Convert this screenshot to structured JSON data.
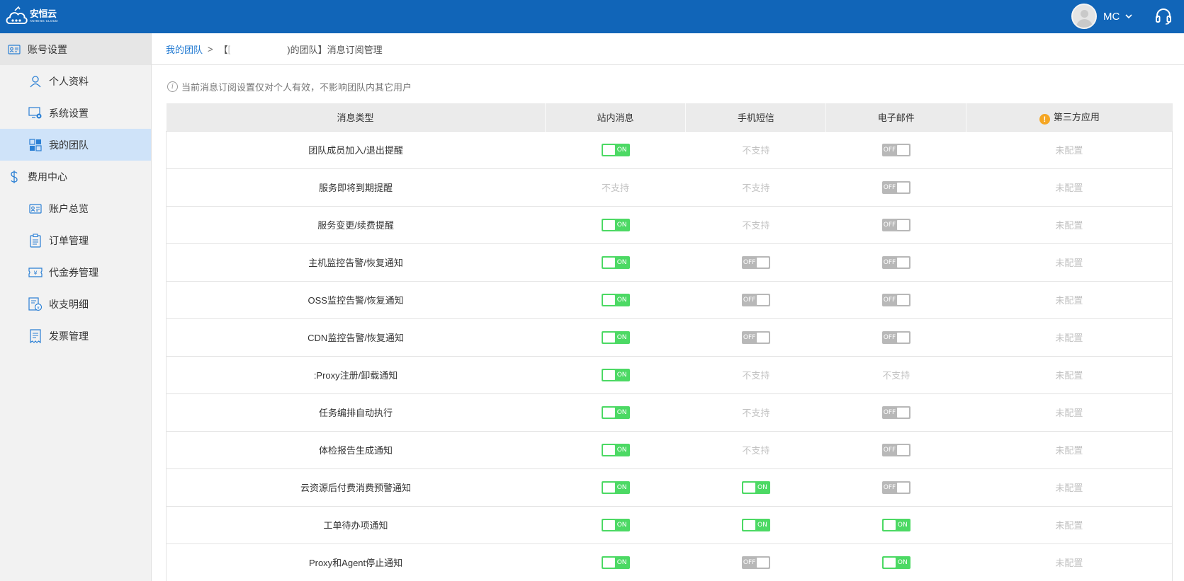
{
  "brand": {
    "name_cn": "安恒云",
    "name_en": "ANHENG CLOUD"
  },
  "user": {
    "name": "MC"
  },
  "sidebar": [
    {
      "label": "账号设置",
      "kind": "group",
      "icon": "id-card-icon",
      "name": "sidebar-group-account-settings"
    },
    {
      "label": "个人资料",
      "kind": "sub",
      "icon": "user-icon",
      "name": "sidebar-item-profile"
    },
    {
      "label": "系统设置",
      "kind": "sub",
      "icon": "monitor-gear-icon",
      "name": "sidebar-item-system-settings"
    },
    {
      "label": "我的团队",
      "kind": "sub",
      "icon": "grid-icon",
      "name": "sidebar-item-my-team",
      "active": true
    },
    {
      "label": "费用中心",
      "kind": "group",
      "icon": "dollar-icon",
      "name": "sidebar-group-billing"
    },
    {
      "label": "账户总览",
      "kind": "sub",
      "icon": "id-card-icon",
      "name": "sidebar-item-account-overview"
    },
    {
      "label": "订单管理",
      "kind": "sub",
      "icon": "clipboard-icon",
      "name": "sidebar-item-orders"
    },
    {
      "label": "代金券管理",
      "kind": "sub",
      "icon": "voucher-icon",
      "name": "sidebar-item-vouchers"
    },
    {
      "label": "收支明细",
      "kind": "sub",
      "icon": "statement-icon",
      "name": "sidebar-item-transactions"
    },
    {
      "label": "发票管理",
      "kind": "sub",
      "icon": "invoice-icon",
      "name": "sidebar-item-invoices"
    }
  ],
  "breadcrumb": {
    "link": "我的团队",
    "sep": ">",
    "open": "【",
    "obscured": "[",
    "suffix": ")的团队】消息订阅管理"
  },
  "notice": "当前消息订阅设置仅对个人有效，不影响团队内其它用户",
  "table": {
    "headers": [
      "消息类型",
      "站内消息",
      "手机短信",
      "电子邮件",
      "第三方应用"
    ],
    "rows": [
      {
        "type": "团队成员加入/退出提醒",
        "cells": [
          "ON",
          "不支持",
          "OFF",
          "未配置"
        ]
      },
      {
        "type": "服务即将到期提醒",
        "cells": [
          "不支持",
          "不支持",
          "OFF",
          "未配置"
        ]
      },
      {
        "type": "服务变更/续费提醒",
        "cells": [
          "ON",
          "不支持",
          "OFF",
          "未配置"
        ]
      },
      {
        "type": "主机监控告警/恢复通知",
        "cells": [
          "ON",
          "OFF",
          "OFF",
          "未配置"
        ]
      },
      {
        "type": "OSS监控告警/恢复通知",
        "cells": [
          "ON",
          "OFF",
          "OFF",
          "未配置"
        ]
      },
      {
        "type": "CDN监控告警/恢复通知",
        "cells": [
          "ON",
          "OFF",
          "OFF",
          "未配置"
        ]
      },
      {
        "type": ":Proxy注册/卸载通知",
        "cells": [
          "ON",
          "不支持",
          "不支持",
          "未配置"
        ]
      },
      {
        "type": "任务编排自动执行",
        "cells": [
          "ON",
          "不支持",
          "OFF",
          "未配置"
        ]
      },
      {
        "type": "体检报告生成通知",
        "cells": [
          "ON",
          "不支持",
          "OFF",
          "未配置"
        ]
      },
      {
        "type": "云资源后付费消费预警通知",
        "cells": [
          "ON",
          "ON",
          "OFF",
          "未配置"
        ]
      },
      {
        "type": "工单待办项通知",
        "cells": [
          "ON",
          "ON",
          "ON",
          "未配置"
        ]
      },
      {
        "type": "Proxy和Agent停止通知",
        "cells": [
          "ON",
          "OFF",
          "ON",
          "未配置"
        ]
      }
    ]
  },
  "colors": {
    "topbar": "#1165b8",
    "switch_on": "#4cd964",
    "switch_off": "#b8b8b8",
    "link": "#1f78d1",
    "active_nav": "#cfe3f9",
    "warning": "#f5a623"
  }
}
